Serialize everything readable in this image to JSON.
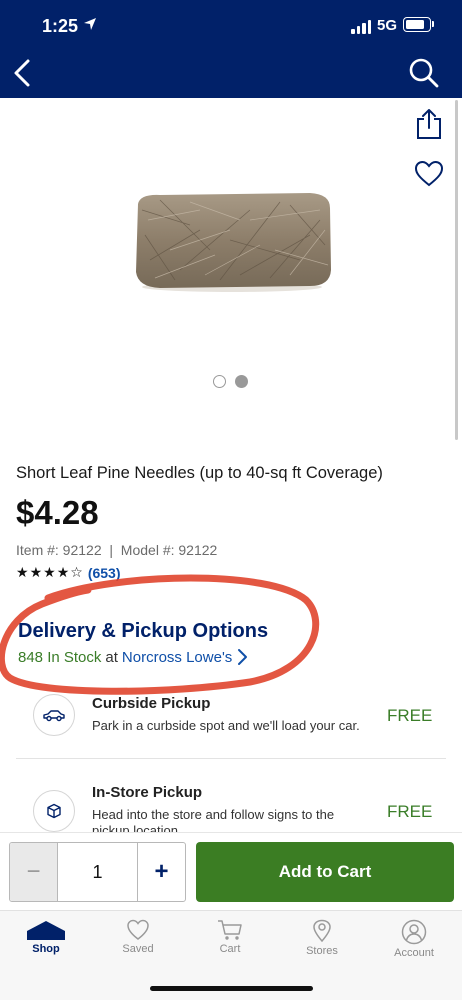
{
  "status_bar": {
    "time": "1:25",
    "network": "5G"
  },
  "product": {
    "title": "Short Leaf Pine Needles (up to 40-sq ft Coverage)",
    "price": "$4.28",
    "item_line": "Item #: 92122  |  Model #: 92122",
    "rating": 4,
    "reviews": "(653)",
    "image_count": 2,
    "image_active_index": 1
  },
  "delivery": {
    "title": "Delivery & Pickup Options",
    "stock": "848 In Stock",
    "at": "at",
    "store": "Norcross Lowe's"
  },
  "options": [
    {
      "title": "Curbside Pickup",
      "desc": "Park in a curbside spot and we'll load your car.",
      "price": "FREE",
      "icon": "car-icon"
    },
    {
      "title": "In-Store Pickup",
      "desc": "Head into the store and follow signs to the pickup location.",
      "price": "FREE",
      "icon": "box-icon"
    }
  ],
  "cart": {
    "quantity": "1",
    "minus": "−",
    "plus": "+",
    "add_label": "Add to Cart"
  },
  "tabs": [
    {
      "label": "Shop",
      "icon": "house-icon",
      "active": true
    },
    {
      "label": "Saved",
      "icon": "heart-icon",
      "active": false
    },
    {
      "label": "Cart",
      "icon": "cart-icon",
      "active": false
    },
    {
      "label": "Stores",
      "icon": "location-pin-icon",
      "active": false
    },
    {
      "label": "Account",
      "icon": "person-icon",
      "active": false
    }
  ],
  "colors": {
    "header": "#012169",
    "accent_green": "#3b7d23",
    "link_blue": "#0f4fa8",
    "annotation_red": "#e0452e"
  }
}
